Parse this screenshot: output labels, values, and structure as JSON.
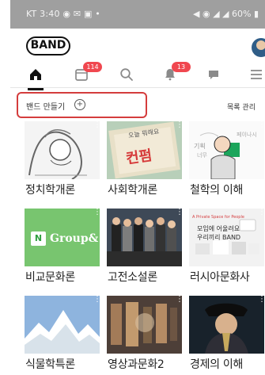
{
  "status": {
    "left": "KT 3:40 ◉ ✉ ▣ •",
    "right": "◀ ◉ ◢ ◢ 60% ▮"
  },
  "app": {
    "logo": "BAND"
  },
  "tabs": [
    {
      "icon": "home-icon",
      "badge": ""
    },
    {
      "icon": "calendar-icon",
      "badge": "114"
    },
    {
      "icon": "search-icon",
      "badge": ""
    },
    {
      "icon": "bell-icon",
      "badge": "13"
    },
    {
      "icon": "chat-icon",
      "badge": ""
    },
    {
      "icon": "menu-icon",
      "badge": ""
    }
  ],
  "actions": {
    "create_band": "밴드 만들기",
    "manage_list": "목록 관리"
  },
  "bands": [
    {
      "title": "정치학개론"
    },
    {
      "title": "사회학개론"
    },
    {
      "title": "철학의 이해"
    },
    {
      "title": "비교문화론"
    },
    {
      "title": "고전소설론"
    },
    {
      "title": "러시아문화사"
    },
    {
      "title": "식물학특론"
    },
    {
      "title": "영상과문화2"
    },
    {
      "title": "경제의 이해"
    }
  ],
  "thumb_text": {
    "paper_top": "오늘 뭐해요",
    "paper_main": "컨펌",
    "doc_text1": "기획",
    "doc_text2": "페이나시",
    "doc_text3": "너무",
    "group": "Group&",
    "banner1": "A Private Space for People",
    "banner2": "모임에 어울려요",
    "banner3": "우리끼리 BAND"
  }
}
